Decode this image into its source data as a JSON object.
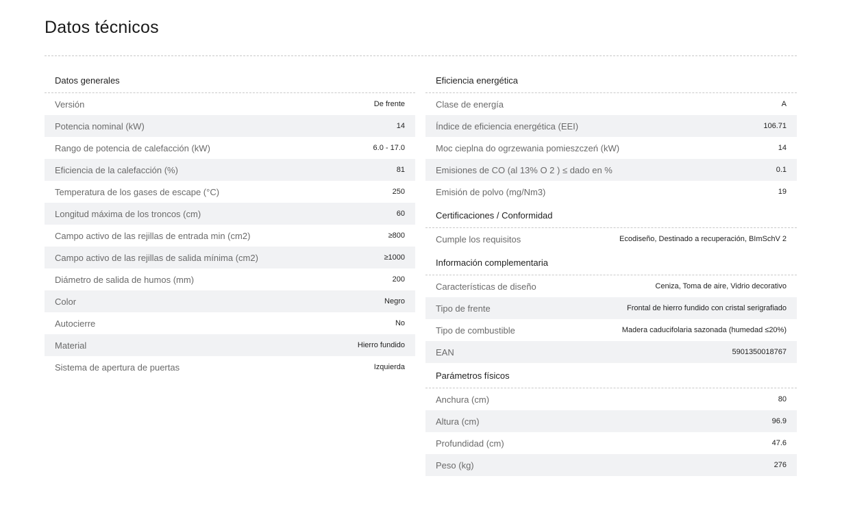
{
  "page": {
    "title": "Datos técnicos"
  },
  "left": {
    "sections": [
      {
        "title": "Datos generales",
        "rows": [
          {
            "label": "Versión",
            "value": "De frente"
          },
          {
            "label": "Potencia nominal (kW)",
            "value": "14"
          },
          {
            "label": "Rango de potencia de calefacción (kW)",
            "value": "6.0 - 17.0"
          },
          {
            "label": "Eficiencia de la calefacción (%)",
            "value": "81"
          },
          {
            "label": "Temperatura de los gases de escape (°C)",
            "value": "250"
          },
          {
            "label": "Longitud máxima de los troncos (cm)",
            "value": "60"
          },
          {
            "label": "Campo activo de las rejillas de entrada min (cm2)",
            "value": "≥800"
          },
          {
            "label": "Campo activo de las rejillas de salida mínima (cm2)",
            "value": "≥1000"
          },
          {
            "label": "Diámetro de salida de humos (mm)",
            "value": "200"
          },
          {
            "label": "Color",
            "value": "Negro"
          },
          {
            "label": "Autocierre",
            "value": "No"
          },
          {
            "label": "Material",
            "value": "Hierro fundido"
          },
          {
            "label": "Sistema de apertura de puertas",
            "value": "Izquierda"
          }
        ]
      }
    ]
  },
  "right": {
    "sections": [
      {
        "title": "Eficiencia energética",
        "rows": [
          {
            "label": "Clase de energía",
            "value": "A"
          },
          {
            "label": "Índice de eficiencia energética (EEI)",
            "value": "106.71"
          },
          {
            "label": "Moc cieplna do ogrzewania pomieszczeń (kW)",
            "value": "14"
          },
          {
            "label": "Emisiones de CO (al 13% O 2 ) ≤ dado en %",
            "value": "0.1"
          },
          {
            "label": "Emisión de polvo (mg/Nm3)",
            "value": "19"
          }
        ]
      },
      {
        "title": "Certificaciones / Conformidad",
        "rows": [
          {
            "label": "Cumple los requisitos",
            "value": "Ecodiseño, Destinado a recuperación, BImSchV 2"
          }
        ]
      },
      {
        "title": "Información complementaria",
        "rows": [
          {
            "label": "Características de diseño",
            "value": "Ceniza, Toma de aire, Vidrio decorativo"
          },
          {
            "label": "Tipo de frente",
            "value": "Frontal de hierro fundido con cristal serigrafiado"
          },
          {
            "label": "Tipo de combustible",
            "value": "Madera caducifolaria sazonada (humedad ≤20%)"
          },
          {
            "label": "EAN",
            "value": "5901350018767"
          }
        ]
      },
      {
        "title": "Parámetros físicos",
        "rows": [
          {
            "label": "Anchura (cm)",
            "value": "80"
          },
          {
            "label": "Altura (cm)",
            "value": "96.9"
          },
          {
            "label": "Profundidad (cm)",
            "value": "47.6"
          },
          {
            "label": "Peso (kg)",
            "value": "276"
          }
        ]
      }
    ]
  }
}
